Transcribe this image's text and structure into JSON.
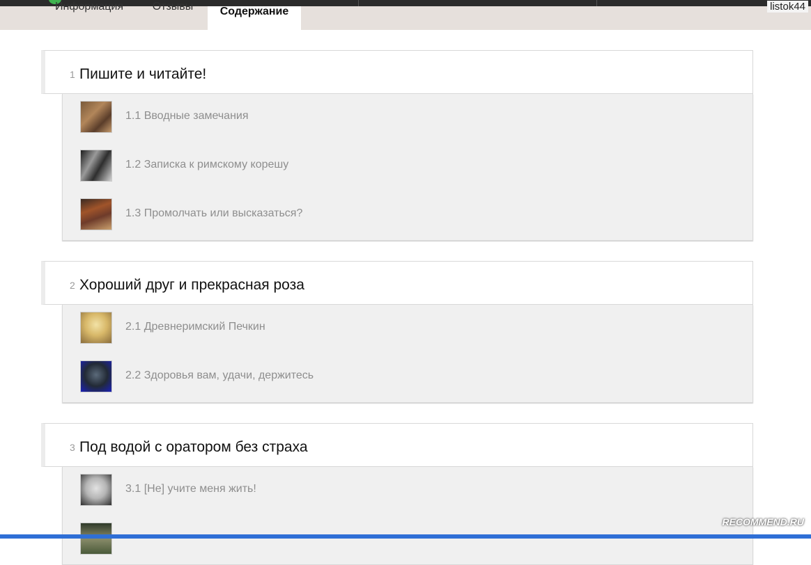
{
  "tabs": [
    {
      "label": "Информация"
    },
    {
      "label": "Отзывы"
    },
    {
      "label": "Содержание"
    }
  ],
  "user": {
    "name": "listok44"
  },
  "chapters": [
    {
      "num": "1",
      "title": "Пишите и читайте!",
      "sections": [
        {
          "title": "1.1 Вводные замечания"
        },
        {
          "title": "1.2 Записка к римскому корешу"
        },
        {
          "title": "1.3 Промолчать или высказаться?"
        }
      ]
    },
    {
      "num": "2",
      "title": "Хороший друг и прекрасная роза",
      "sections": [
        {
          "title": "2.1 Древнеримский Печкин"
        },
        {
          "title": "2.2 Здоровья вам, удачи, держитесь"
        }
      ]
    },
    {
      "num": "3",
      "title": "Под водой с оратором без страха",
      "sections": [
        {
          "title": "3.1 [Не] учите меня жить!"
        },
        {
          "title": ""
        }
      ]
    }
  ],
  "watermark": "RECOMMEND.RU"
}
